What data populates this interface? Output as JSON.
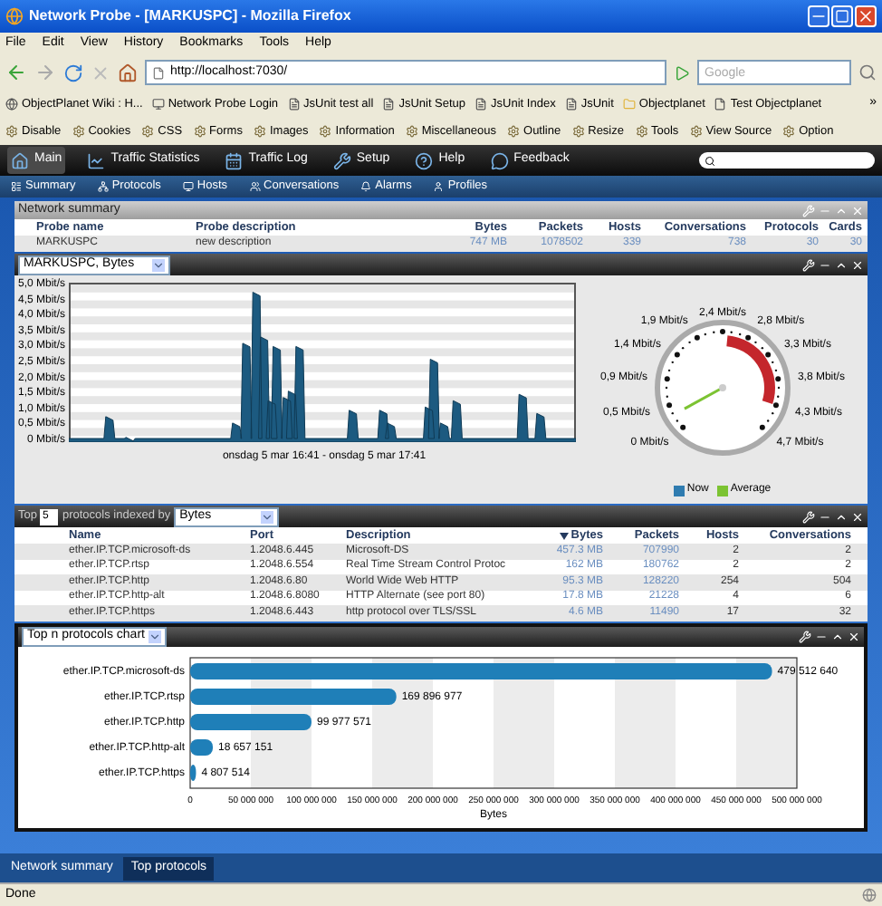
{
  "window": {
    "title": "Network Probe - [MARKUSPC] - Mozilla Firefox"
  },
  "menu": [
    "File",
    "Edit",
    "View",
    "History",
    "Bookmarks",
    "Tools",
    "Help"
  ],
  "address": {
    "value": "http://localhost:7030/"
  },
  "search": {
    "placeholder": "Google"
  },
  "bookmarks": [
    {
      "label": "ObjectPlanet Wiki : H...",
      "kind": "wiki"
    },
    {
      "label": "Network Probe Login",
      "kind": "login"
    },
    {
      "label": "JsUnit test all",
      "kind": "page"
    },
    {
      "label": "JsUnit Setup",
      "kind": "page"
    },
    {
      "label": "JsUnit Index",
      "kind": "page"
    },
    {
      "label": "JsUnit",
      "kind": "page"
    },
    {
      "label": "Objectplanet",
      "kind": "folder"
    },
    {
      "label": "Test Objectplanet",
      "kind": "blank"
    }
  ],
  "bookmarks_more": "»",
  "devtools": [
    "Disable",
    "Cookies",
    "CSS",
    "Forms",
    "Images",
    "Information",
    "Miscellaneous",
    "Outline",
    "Resize",
    "Tools",
    "View Source",
    "Option"
  ],
  "app_nav": [
    {
      "label": "Main",
      "kind": "home",
      "selected": true
    },
    {
      "label": "Traffic Statistics",
      "kind": "chart",
      "selected": false
    },
    {
      "label": "Traffic Log",
      "kind": "calendar",
      "selected": false
    },
    {
      "label": "Setup",
      "kind": "wrench",
      "selected": false
    },
    {
      "label": "Help",
      "kind": "help",
      "selected": false
    },
    {
      "label": "Feedback",
      "kind": "feedback",
      "selected": false
    }
  ],
  "sub_nav": [
    {
      "label": "Summary",
      "kind": "summary"
    },
    {
      "label": "Protocols",
      "kind": "protocols"
    },
    {
      "label": "Hosts",
      "kind": "hosts"
    },
    {
      "label": "Conversations",
      "kind": "conversations"
    },
    {
      "label": "Alarms",
      "kind": "alarms"
    },
    {
      "label": "Profiles",
      "kind": "profiles"
    }
  ],
  "network_summary": {
    "title": "Network summary",
    "columns": [
      "Probe name",
      "Probe description",
      "Bytes",
      "Packets",
      "Hosts",
      "Conversations",
      "Protocols",
      "Cards"
    ],
    "rows": [
      [
        "MARKUSPC",
        "new description",
        "747 MB",
        "1078502",
        "339",
        "738",
        "30",
        "30"
      ]
    ]
  },
  "traffic_panel": {
    "selector": "MARKUSPC, Bytes",
    "y_ticks": [
      "5,0 Mbit/s",
      "4,5 Mbit/s",
      "4,0 Mbit/s",
      "3,5 Mbit/s",
      "3,0 Mbit/s",
      "2,5 Mbit/s",
      "2,0 Mbit/s",
      "1,5 Mbit/s",
      "1,0 Mbit/s",
      "0,5 Mbit/s",
      "0 Mbit/s"
    ],
    "x_label": "onsdag 5 mar 16:41 - onsdag 5 mar 17:41",
    "gauge": {
      "top_label": "2,4 Mbit/s",
      "left_labels": [
        "1,9 Mbit/s",
        "1,4 Mbit/s",
        "0,9 Mbit/s",
        "0,5 Mbit/s",
        "0 Mbit/s"
      ],
      "right_labels": [
        "2,8 Mbit/s",
        "3,3 Mbit/s",
        "3,8 Mbit/s",
        "4,3 Mbit/s",
        "4,7 Mbit/s"
      ],
      "level": 0.06
    },
    "legend": [
      {
        "label": "Now",
        "color": "#2f7cb0"
      },
      {
        "label": "Average",
        "color": "#7cc332"
      }
    ]
  },
  "protocols": {
    "top_label": "Top",
    "count": "5",
    "indexed_label": "protocols indexed by",
    "index_by": "Bytes",
    "columns": [
      {
        "label": "Name",
        "sorted": false
      },
      {
        "label": "Port",
        "sorted": false
      },
      {
        "label": "Description",
        "sorted": false
      },
      {
        "label": "Bytes",
        "sorted": true
      },
      {
        "label": "Packets",
        "sorted": false
      },
      {
        "label": "Hosts",
        "sorted": false
      },
      {
        "label": "Conversations",
        "sorted": false
      }
    ],
    "rows": [
      [
        "ether.IP.TCP.microsoft-ds",
        "1.2048.6.445",
        "Microsoft-DS",
        "457.3 MB",
        "707990",
        "2",
        "2"
      ],
      [
        "ether.IP.TCP.rtsp",
        "1.2048.6.554",
        "Real Time Stream Control Protoc",
        "162 MB",
        "180762",
        "2",
        "2"
      ],
      [
        "ether.IP.TCP.http",
        "1.2048.6.80",
        "World Wide Web HTTP",
        "95.3 MB",
        "128220",
        "254",
        "504"
      ],
      [
        "ether.IP.TCP.http-alt",
        "1.2048.6.8080",
        "HTTP Alternate (see port 80)",
        "17.8 MB",
        "21228",
        "4",
        "6"
      ],
      [
        "ether.IP.TCP.https",
        "1.2048.6.443",
        "http protocol over TLS/SSL",
        "4.6 MB",
        "11490",
        "17",
        "32"
      ]
    ]
  },
  "protocols_chart": {
    "selector": "Top n protocols chart",
    "chart_data": {
      "type": "bar",
      "orientation": "horizontal",
      "xlabel": "Bytes",
      "categories": [
        "ether.IP.TCP.microsoft-ds",
        "ether.IP.TCP.rtsp",
        "ether.IP.TCP.http",
        "ether.IP.TCP.http-alt",
        "ether.IP.TCP.https"
      ],
      "series": [
        {
          "color": "#1f7fb8",
          "values": [
            479512640,
            169896977,
            99977571,
            18657151,
            4807514
          ]
        }
      ],
      "value_labels": [
        "479 512 640",
        "169 896 977",
        "99 977 571",
        "18 657 151",
        "4 807 514"
      ],
      "xlim": [
        0,
        500000000
      ],
      "xticks": [
        {
          "value": 0,
          "label": "0"
        },
        {
          "value": 50000000,
          "label": "50 000 000"
        },
        {
          "value": 100000000,
          "label": "100 000 000"
        },
        {
          "value": 150000000,
          "label": "150 000 000"
        },
        {
          "value": 200000000,
          "label": "200 000 000"
        },
        {
          "value": 250000000,
          "label": "250 000 000"
        },
        {
          "value": 300000000,
          "label": "300 000 000"
        },
        {
          "value": 350000000,
          "label": "350 000 000"
        },
        {
          "value": 400000000,
          "label": "400 000 000"
        },
        {
          "value": 450000000,
          "label": "450 000 000"
        },
        {
          "value": 500000000,
          "label": "500 000 000"
        }
      ]
    }
  },
  "bottom_tabs": [
    {
      "label": "Network summary",
      "selected": false
    },
    {
      "label": "Top protocols",
      "selected": true
    }
  ],
  "status_bar": {
    "text": "Done"
  }
}
